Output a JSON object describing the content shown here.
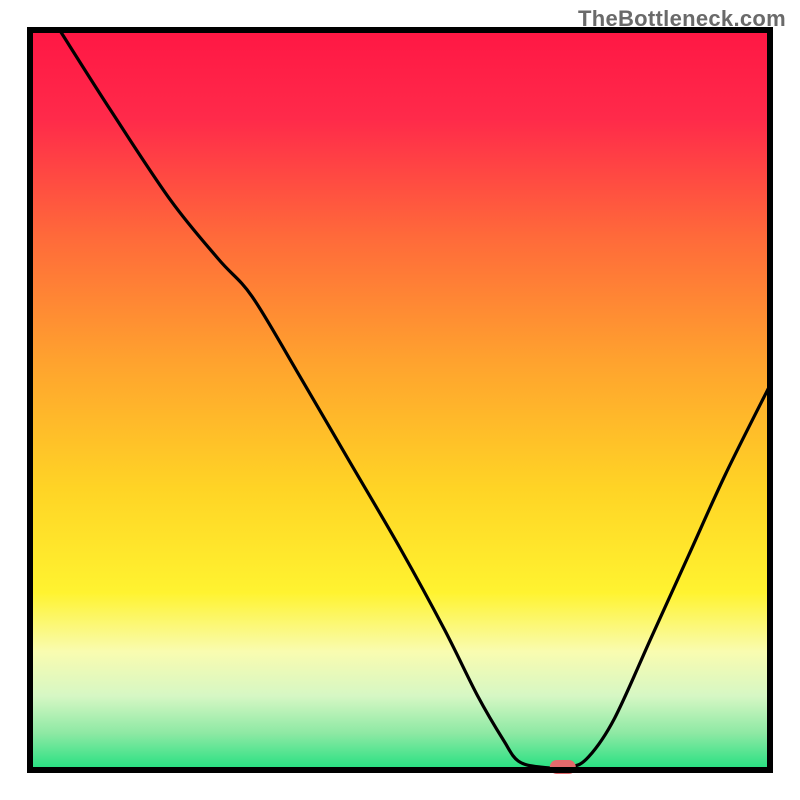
{
  "watermark": "TheBottleneck.com",
  "chart_data": {
    "type": "line",
    "title": "",
    "subtitle": "",
    "xlabel": "",
    "ylabel": "",
    "xlim": [
      0,
      1
    ],
    "ylim": [
      0,
      1
    ],
    "grid": false,
    "legend": false,
    "gradient_stops": [
      {
        "offset": 0.0,
        "color": "#ff1744"
      },
      {
        "offset": 0.12,
        "color": "#ff2a4a"
      },
      {
        "offset": 0.28,
        "color": "#ff6a3a"
      },
      {
        "offset": 0.45,
        "color": "#ffa32e"
      },
      {
        "offset": 0.62,
        "color": "#ffd425"
      },
      {
        "offset": 0.76,
        "color": "#fff330"
      },
      {
        "offset": 0.84,
        "color": "#f9fcb0"
      },
      {
        "offset": 0.9,
        "color": "#d6f7c4"
      },
      {
        "offset": 0.95,
        "color": "#8ee9a4"
      },
      {
        "offset": 1.0,
        "color": "#23e080"
      }
    ],
    "curve": [
      {
        "x": 0.04,
        "y": 1.0
      },
      {
        "x": 0.11,
        "y": 0.89
      },
      {
        "x": 0.19,
        "y": 0.77
      },
      {
        "x": 0.255,
        "y": 0.69
      },
      {
        "x": 0.3,
        "y": 0.64
      },
      {
        "x": 0.36,
        "y": 0.54
      },
      {
        "x": 0.43,
        "y": 0.42
      },
      {
        "x": 0.5,
        "y": 0.3
      },
      {
        "x": 0.56,
        "y": 0.19
      },
      {
        "x": 0.605,
        "y": 0.1
      },
      {
        "x": 0.64,
        "y": 0.04
      },
      {
        "x": 0.66,
        "y": 0.012
      },
      {
        "x": 0.69,
        "y": 0.004
      },
      {
        "x": 0.73,
        "y": 0.004
      },
      {
        "x": 0.755,
        "y": 0.018
      },
      {
        "x": 0.79,
        "y": 0.07
      },
      {
        "x": 0.84,
        "y": 0.18
      },
      {
        "x": 0.89,
        "y": 0.29
      },
      {
        "x": 0.94,
        "y": 0.4
      },
      {
        "x": 1.0,
        "y": 0.52
      }
    ],
    "marker": {
      "x": 0.72,
      "y": 0.004,
      "color": "#e46a6c"
    }
  }
}
